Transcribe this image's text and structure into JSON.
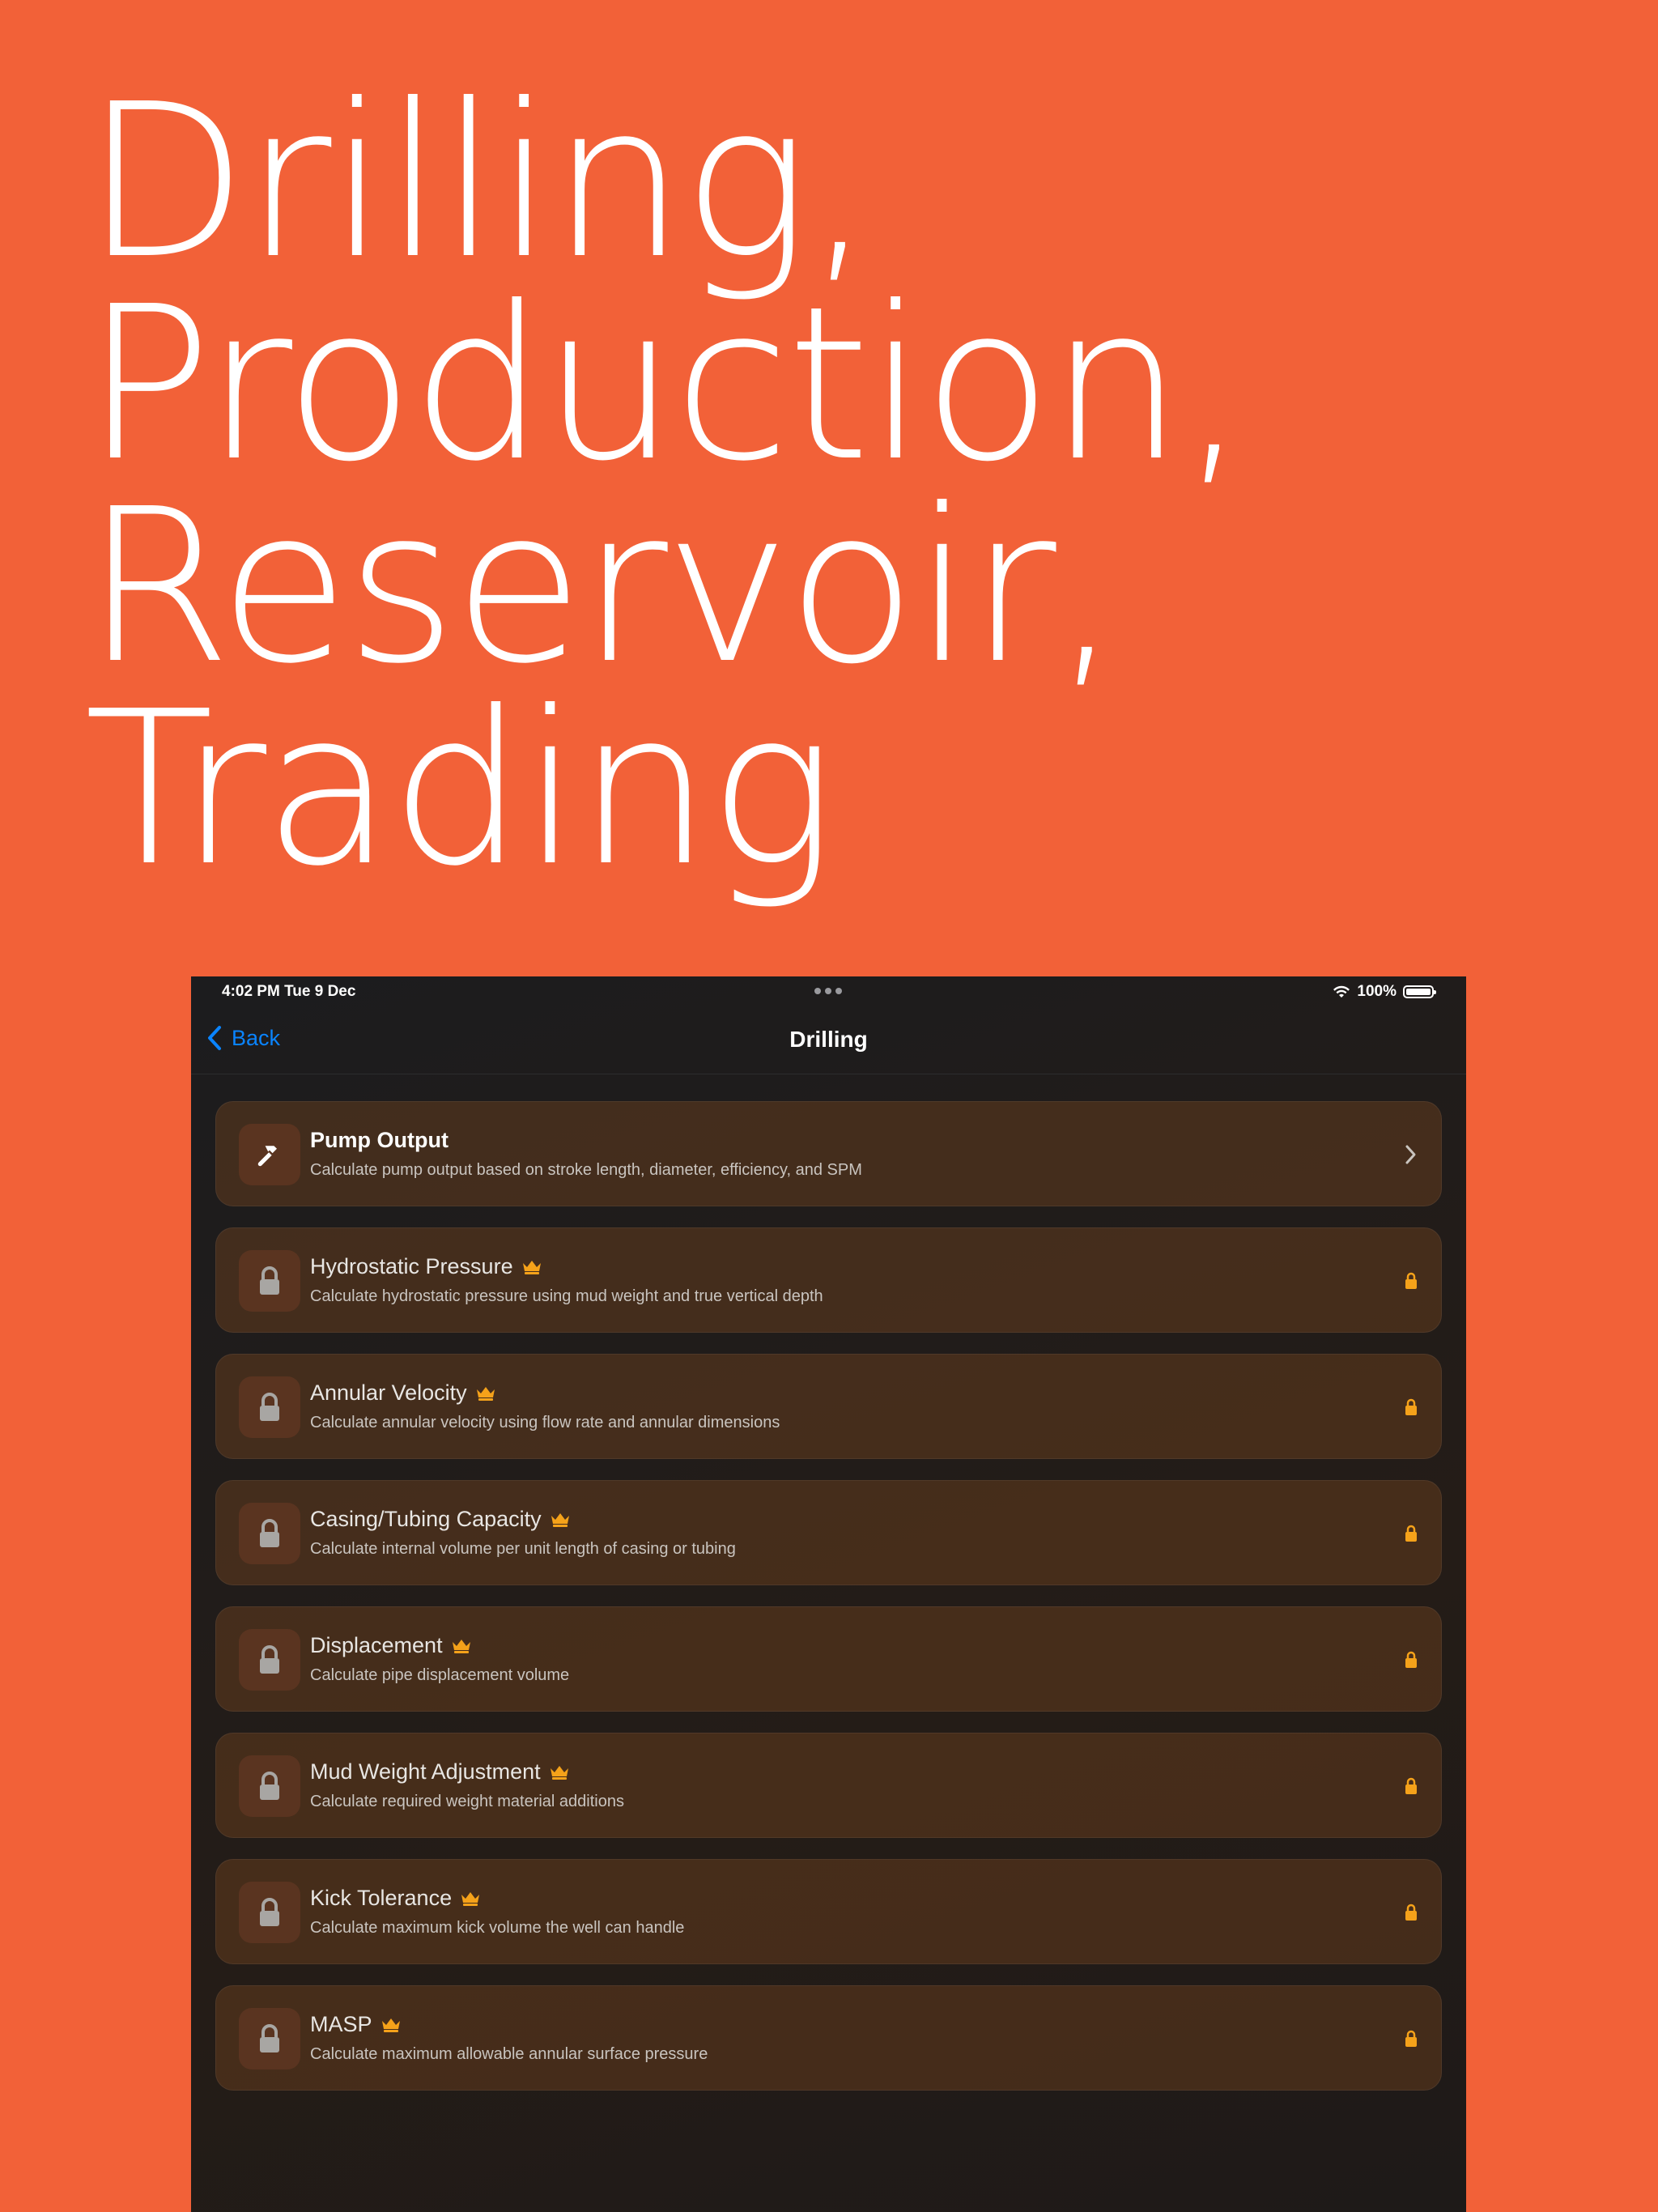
{
  "headline": [
    "Drilling,",
    "Production,",
    "Reservoir,",
    "Trading"
  ],
  "status": {
    "time": "4:02 PM   Tue 9 Dec",
    "battery": "100%"
  },
  "nav": {
    "back_label": "Back",
    "title": "Drilling"
  },
  "colors": {
    "background": "#F26138",
    "accent": "#0A84FF",
    "lock": "#F5A21A"
  },
  "items": [
    {
      "title": "Pump Output",
      "desc": "Calculate pump output based on stroke length, diameter, efficiency, and SPM",
      "locked": false,
      "icon": "hammer-icon"
    },
    {
      "title": "Hydrostatic Pressure",
      "desc": "Calculate hydrostatic pressure using mud weight and true vertical depth",
      "locked": true,
      "icon": "lock-icon"
    },
    {
      "title": "Annular Velocity",
      "desc": "Calculate annular velocity using flow rate and annular dimensions",
      "locked": true,
      "icon": "lock-icon"
    },
    {
      "title": "Casing/Tubing Capacity",
      "desc": "Calculate internal volume per unit length of casing or tubing",
      "locked": true,
      "icon": "lock-icon"
    },
    {
      "title": "Displacement",
      "desc": "Calculate pipe displacement volume",
      "locked": true,
      "icon": "lock-icon"
    },
    {
      "title": "Mud Weight Adjustment",
      "desc": "Calculate required weight material additions",
      "locked": true,
      "icon": "lock-icon"
    },
    {
      "title": "Kick Tolerance",
      "desc": "Calculate maximum kick volume the well can handle",
      "locked": true,
      "icon": "lock-icon"
    },
    {
      "title": "MASP",
      "desc": "Calculate maximum allowable annular surface pressure",
      "locked": true,
      "icon": "lock-icon"
    }
  ]
}
